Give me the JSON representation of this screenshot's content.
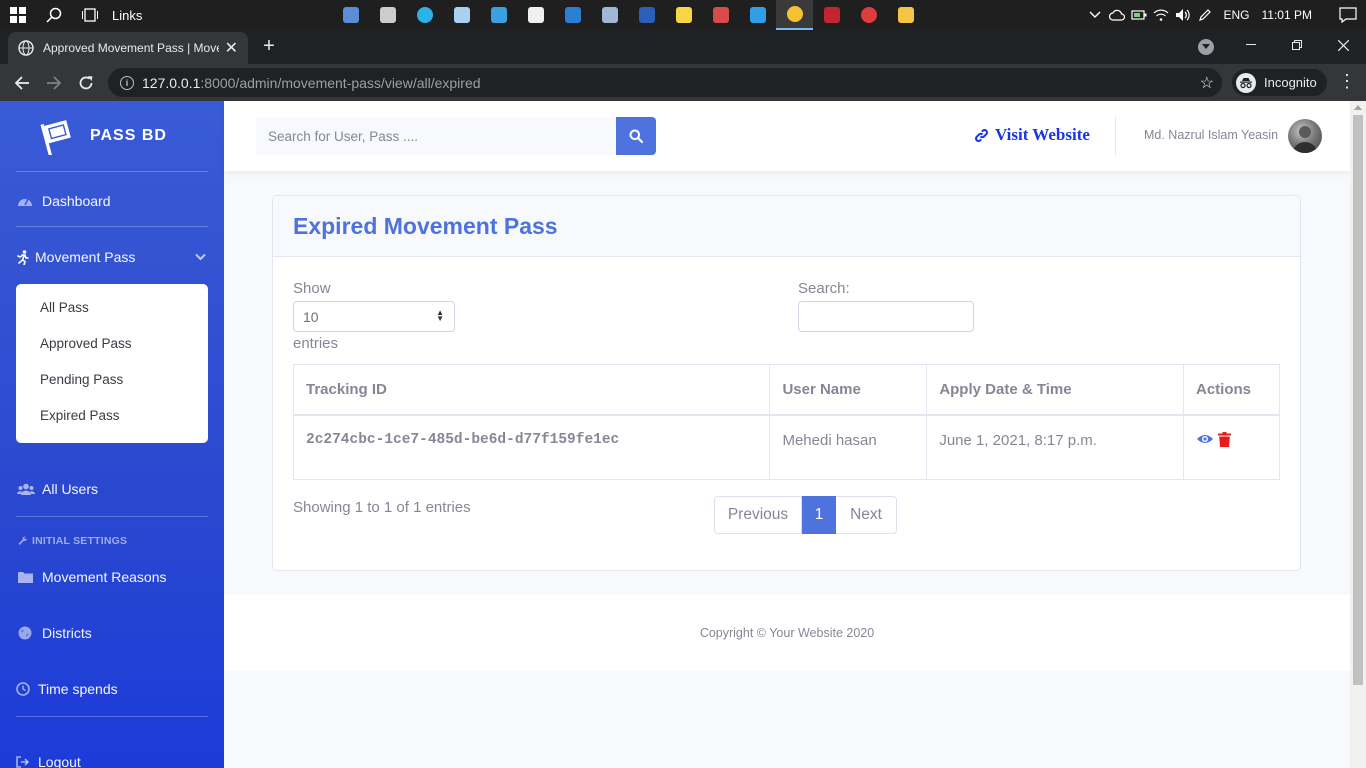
{
  "taskbar": {
    "links_label": "Links",
    "language": "ENG",
    "time": "11:01 PM",
    "apps": [
      {
        "icon": "monitor-app-icon",
        "color": "#5a8fd6"
      },
      {
        "icon": "terminal-icon",
        "color": "#cccccc"
      },
      {
        "icon": "edge-icon",
        "color": "#2bb3e8"
      },
      {
        "icon": "notepad-icon",
        "color": "#a8d0f0"
      },
      {
        "icon": "remote-desktop-icon",
        "color": "#3aa0e0"
      },
      {
        "icon": "store-icon",
        "color": "#f0f0f0"
      },
      {
        "icon": "mail-icon",
        "color": "#2a7fd4"
      },
      {
        "icon": "calculator-icon",
        "color": "#9fb8d6"
      },
      {
        "icon": "word-icon",
        "color": "#2b5fb8"
      },
      {
        "icon": "sticky-notes-icon",
        "color": "#f4d742"
      },
      {
        "icon": "photos-icon",
        "color": "#d84b4b"
      },
      {
        "icon": "vscode-icon",
        "color": "#2f9fe8"
      },
      {
        "icon": "chrome-icon",
        "color": "#f2c230"
      },
      {
        "icon": "app-icon",
        "color": "#c0262b"
      },
      {
        "icon": "record-icon",
        "color": "#e13c3c"
      },
      {
        "icon": "file-explorer-icon",
        "color": "#f6c544"
      }
    ],
    "active_app_index": 12
  },
  "browser": {
    "tab_title": "Approved Movement Pass | Movement Pass",
    "url_host": "127.0.0.1",
    "url_path": ":8000/admin/movement-pass/view/all/expired",
    "profile_label": "Incognito"
  },
  "sidebar": {
    "brand": "PASS BD",
    "dashboard": "Dashboard",
    "movement_pass": "Movement Pass",
    "sub_items": [
      "All Pass",
      "Approved Pass",
      "Pending Pass",
      "Expired Pass"
    ],
    "all_users": "All Users",
    "heading": "INITIAL SETTINGS",
    "movement_reasons": "Movement Reasons",
    "districts": "Districts",
    "time_spends": "Time spends",
    "logout": "Logout"
  },
  "topbar": {
    "search_placeholder": "Search for User, Pass ....",
    "visit_website": "Visit Website",
    "user_name": "Md. Nazrul Islam Yeasin"
  },
  "card": {
    "title": "Expired Movement Pass",
    "show_label": "Show",
    "page_length": "10",
    "entries_label": "entries",
    "search_label": "Search:",
    "columns": [
      "Tracking ID",
      "User Name",
      "Apply Date & Time",
      "Actions"
    ],
    "rows": [
      {
        "tracking_id": "2c274cbc-1ce7-485d-be6d-d77f159fe1ec",
        "user_name": "Mehedi hasan",
        "apply_datetime": "June 1, 2021, 8:17 p.m."
      }
    ],
    "info": "Showing 1 to 1 of 1 entries",
    "pagination": {
      "previous": "Previous",
      "current": "1",
      "next": "Next"
    }
  },
  "footer": {
    "copyright": "Copyright © Your Website 2020"
  },
  "colors": {
    "primary": "#4e73df",
    "link": "#1a35e6",
    "danger": "#e81a1a",
    "text_muted": "#858796"
  }
}
